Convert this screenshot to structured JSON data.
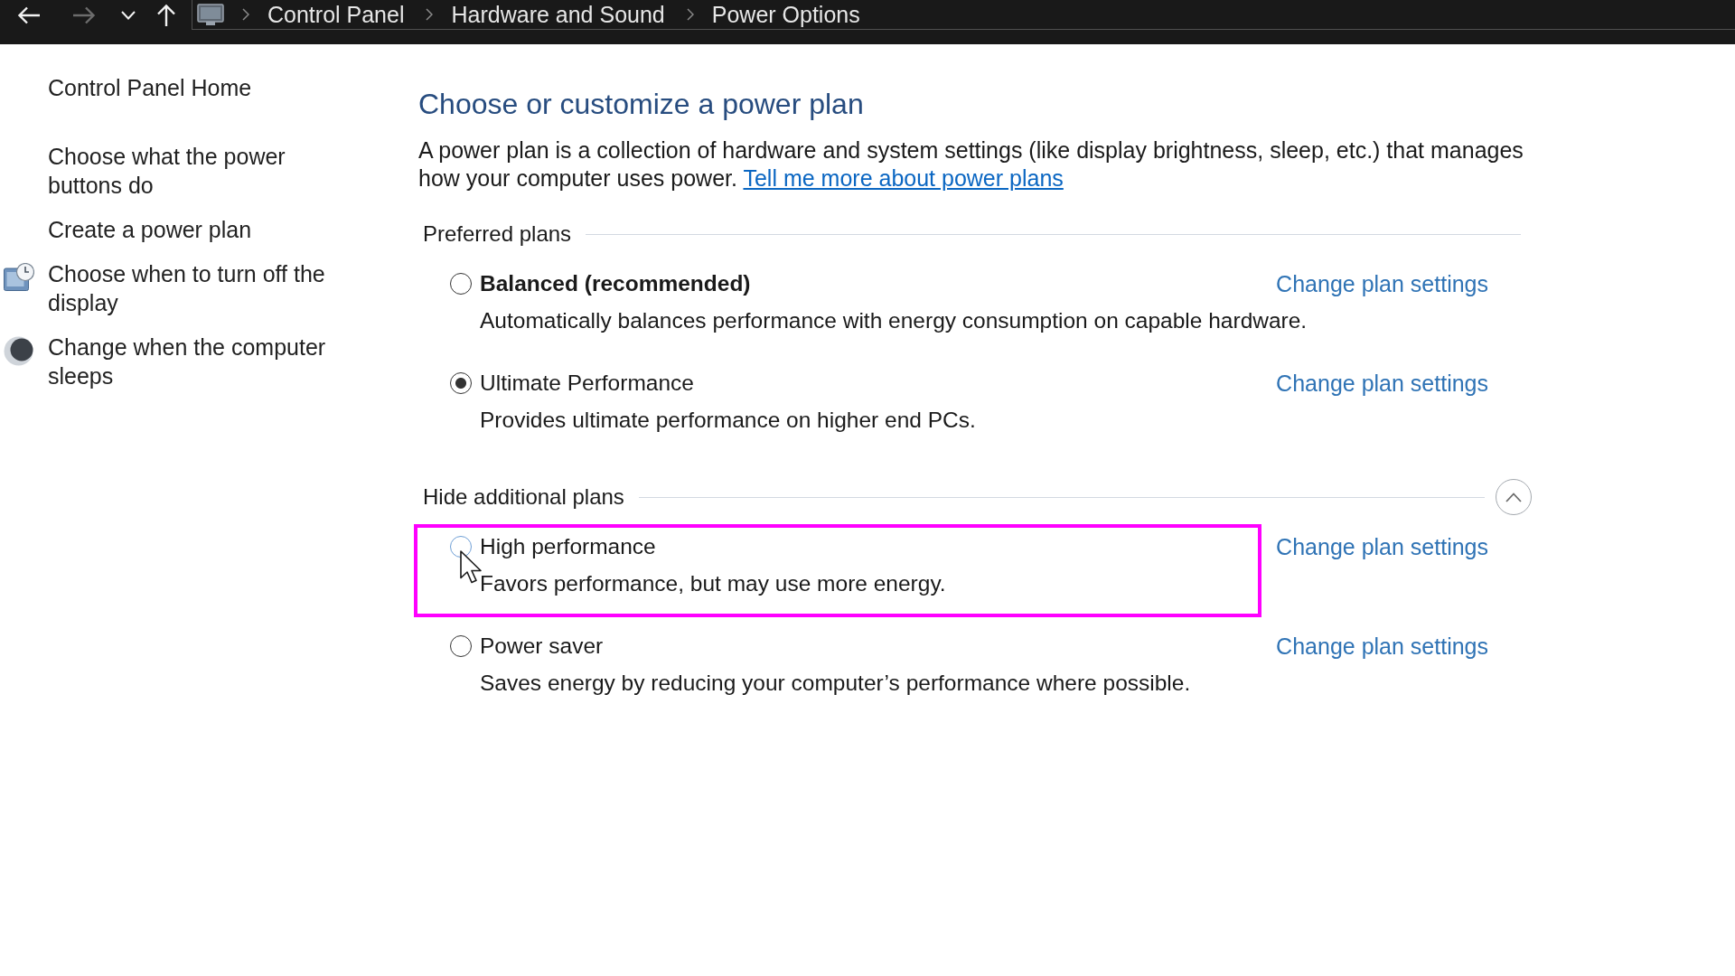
{
  "nav_buttons": [
    {
      "kind": "back",
      "disabled": false
    },
    {
      "kind": "forward",
      "disabled": true
    },
    {
      "kind": "recent",
      "disabled": false
    },
    {
      "kind": "up",
      "disabled": false
    }
  ],
  "breadcrumb": [
    "Control Panel",
    "Hardware and Sound",
    "Power Options"
  ],
  "sidebar": {
    "home": "Control Panel Home",
    "links": [
      {
        "label": "Choose what the power buttons do",
        "kind": "plain"
      },
      {
        "label": "Create a power plan",
        "kind": "plain"
      },
      {
        "label": "Choose when to turn off the display",
        "kind": "display"
      },
      {
        "label": "Change when the computer sleeps",
        "kind": "sleep"
      }
    ]
  },
  "main": {
    "heading": "Choose or customize a power plan",
    "intro": "A power plan is a collection of hardware and system settings (like display brightness, sleep, etc.) that manages how your computer uses power.",
    "intro_link": "Tell me more about power plans"
  },
  "plan_groups": [
    {
      "title": "Preferred plans",
      "plans": [
        {
          "name": "Balanced (recommended)",
          "bold": true,
          "description": "Automatically balances performance with energy consumption on capable hardware.",
          "selected": false,
          "hovered": false,
          "highlighted": false,
          "link": "Change plan settings"
        },
        {
          "name": "Ultimate Performance",
          "bold": false,
          "description": "Provides ultimate performance on higher end PCs.",
          "selected": true,
          "hovered": false,
          "highlighted": false,
          "link": "Change plan settings"
        }
      ]
    },
    {
      "title": "Hide additional plans",
      "expanded": true,
      "plans": [
        {
          "name": "High performance",
          "bold": false,
          "description": "Favors performance, but may use more energy.",
          "selected": false,
          "hovered": true,
          "highlighted": true,
          "link": "Change plan settings"
        },
        {
          "name": "Power saver",
          "bold": false,
          "description": "Saves energy by reducing your computer’s performance where possible.",
          "selected": false,
          "hovered": false,
          "highlighted": false,
          "link": "Change plan settings"
        }
      ]
    }
  ]
}
